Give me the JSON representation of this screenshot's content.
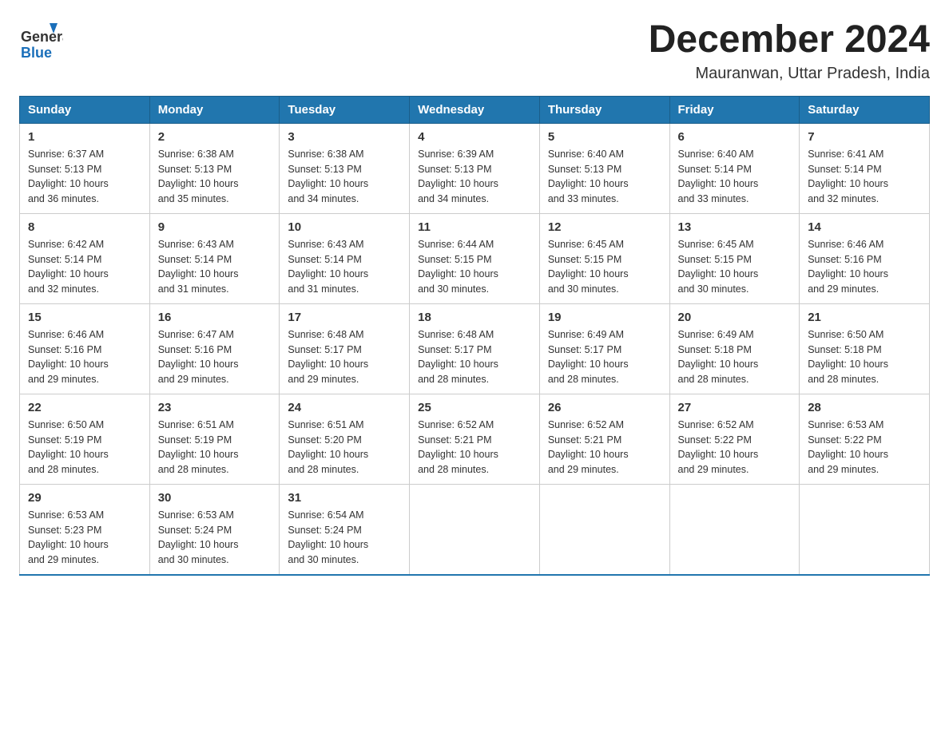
{
  "logo": {
    "text_general": "General",
    "text_blue": "Blue"
  },
  "header": {
    "title": "December 2024",
    "subtitle": "Mauranwan, Uttar Pradesh, India"
  },
  "columns": [
    "Sunday",
    "Monday",
    "Tuesday",
    "Wednesday",
    "Thursday",
    "Friday",
    "Saturday"
  ],
  "weeks": [
    [
      {
        "day": "1",
        "sunrise": "6:37 AM",
        "sunset": "5:13 PM",
        "daylight": "10 hours and 36 minutes."
      },
      {
        "day": "2",
        "sunrise": "6:38 AM",
        "sunset": "5:13 PM",
        "daylight": "10 hours and 35 minutes."
      },
      {
        "day": "3",
        "sunrise": "6:38 AM",
        "sunset": "5:13 PM",
        "daylight": "10 hours and 34 minutes."
      },
      {
        "day": "4",
        "sunrise": "6:39 AM",
        "sunset": "5:13 PM",
        "daylight": "10 hours and 34 minutes."
      },
      {
        "day": "5",
        "sunrise": "6:40 AM",
        "sunset": "5:13 PM",
        "daylight": "10 hours and 33 minutes."
      },
      {
        "day": "6",
        "sunrise": "6:40 AM",
        "sunset": "5:14 PM",
        "daylight": "10 hours and 33 minutes."
      },
      {
        "day": "7",
        "sunrise": "6:41 AM",
        "sunset": "5:14 PM",
        "daylight": "10 hours and 32 minutes."
      }
    ],
    [
      {
        "day": "8",
        "sunrise": "6:42 AM",
        "sunset": "5:14 PM",
        "daylight": "10 hours and 32 minutes."
      },
      {
        "day": "9",
        "sunrise": "6:43 AM",
        "sunset": "5:14 PM",
        "daylight": "10 hours and 31 minutes."
      },
      {
        "day": "10",
        "sunrise": "6:43 AM",
        "sunset": "5:14 PM",
        "daylight": "10 hours and 31 minutes."
      },
      {
        "day": "11",
        "sunrise": "6:44 AM",
        "sunset": "5:15 PM",
        "daylight": "10 hours and 30 minutes."
      },
      {
        "day": "12",
        "sunrise": "6:45 AM",
        "sunset": "5:15 PM",
        "daylight": "10 hours and 30 minutes."
      },
      {
        "day": "13",
        "sunrise": "6:45 AM",
        "sunset": "5:15 PM",
        "daylight": "10 hours and 30 minutes."
      },
      {
        "day": "14",
        "sunrise": "6:46 AM",
        "sunset": "5:16 PM",
        "daylight": "10 hours and 29 minutes."
      }
    ],
    [
      {
        "day": "15",
        "sunrise": "6:46 AM",
        "sunset": "5:16 PM",
        "daylight": "10 hours and 29 minutes."
      },
      {
        "day": "16",
        "sunrise": "6:47 AM",
        "sunset": "5:16 PM",
        "daylight": "10 hours and 29 minutes."
      },
      {
        "day": "17",
        "sunrise": "6:48 AM",
        "sunset": "5:17 PM",
        "daylight": "10 hours and 29 minutes."
      },
      {
        "day": "18",
        "sunrise": "6:48 AM",
        "sunset": "5:17 PM",
        "daylight": "10 hours and 28 minutes."
      },
      {
        "day": "19",
        "sunrise": "6:49 AM",
        "sunset": "5:17 PM",
        "daylight": "10 hours and 28 minutes."
      },
      {
        "day": "20",
        "sunrise": "6:49 AM",
        "sunset": "5:18 PM",
        "daylight": "10 hours and 28 minutes."
      },
      {
        "day": "21",
        "sunrise": "6:50 AM",
        "sunset": "5:18 PM",
        "daylight": "10 hours and 28 minutes."
      }
    ],
    [
      {
        "day": "22",
        "sunrise": "6:50 AM",
        "sunset": "5:19 PM",
        "daylight": "10 hours and 28 minutes."
      },
      {
        "day": "23",
        "sunrise": "6:51 AM",
        "sunset": "5:19 PM",
        "daylight": "10 hours and 28 minutes."
      },
      {
        "day": "24",
        "sunrise": "6:51 AM",
        "sunset": "5:20 PM",
        "daylight": "10 hours and 28 minutes."
      },
      {
        "day": "25",
        "sunrise": "6:52 AM",
        "sunset": "5:21 PM",
        "daylight": "10 hours and 28 minutes."
      },
      {
        "day": "26",
        "sunrise": "6:52 AM",
        "sunset": "5:21 PM",
        "daylight": "10 hours and 29 minutes."
      },
      {
        "day": "27",
        "sunrise": "6:52 AM",
        "sunset": "5:22 PM",
        "daylight": "10 hours and 29 minutes."
      },
      {
        "day": "28",
        "sunrise": "6:53 AM",
        "sunset": "5:22 PM",
        "daylight": "10 hours and 29 minutes."
      }
    ],
    [
      {
        "day": "29",
        "sunrise": "6:53 AM",
        "sunset": "5:23 PM",
        "daylight": "10 hours and 29 minutes."
      },
      {
        "day": "30",
        "sunrise": "6:53 AM",
        "sunset": "5:24 PM",
        "daylight": "10 hours and 30 minutes."
      },
      {
        "day": "31",
        "sunrise": "6:54 AM",
        "sunset": "5:24 PM",
        "daylight": "10 hours and 30 minutes."
      },
      null,
      null,
      null,
      null
    ]
  ],
  "colors": {
    "header_bg": "#2176ae",
    "header_text": "#ffffff",
    "border": "#cccccc"
  },
  "labels": {
    "sunrise": "Sunrise:",
    "sunset": "Sunset:",
    "daylight": "Daylight:"
  }
}
